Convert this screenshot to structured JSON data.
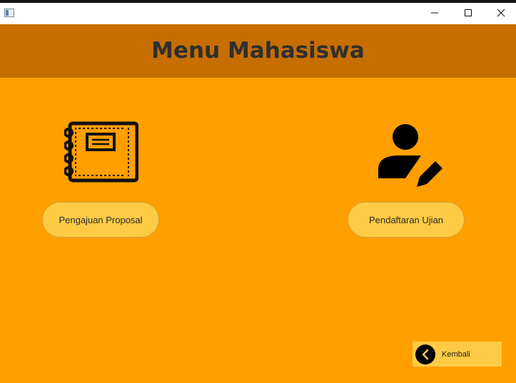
{
  "window": {
    "controls": {
      "minimize": "minimize-icon",
      "maximize": "maximize-icon",
      "close": "close-icon"
    }
  },
  "header": {
    "title": "Menu Mahasiswa"
  },
  "menu": {
    "proposal": {
      "label": "Pengajuan Proposal",
      "icon": "notebook-icon"
    },
    "ujian": {
      "label": "Pendaftaran Ujian",
      "icon": "user-edit-icon"
    }
  },
  "footer": {
    "back_label": "Kembali",
    "back_icon": "chevron-left-icon"
  },
  "colors": {
    "background": "#ff9f00",
    "header": "#c66e00",
    "button": "#ffcb45",
    "title_text": "#2f2f2f"
  }
}
